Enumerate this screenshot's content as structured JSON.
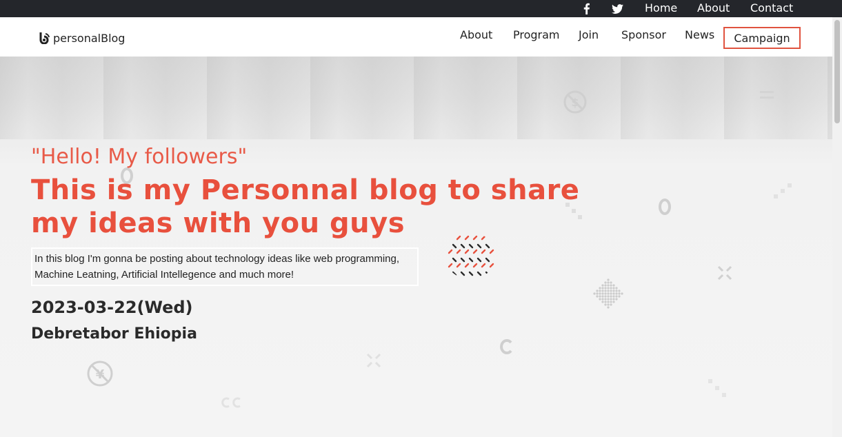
{
  "topbar": {
    "social_icons": [
      "facebook-icon",
      "twitter-icon"
    ],
    "links": [
      "Home",
      "About",
      "Contact"
    ]
  },
  "navbar": {
    "logo_text": "personalBlog",
    "items": [
      "About",
      "Program",
      "Join",
      "Sponsor",
      "News"
    ],
    "campaign_label": "Campaign"
  },
  "hero": {
    "greeting": "\"Hello! My followers\"",
    "headline_line1": "This is my Personnal blog to share",
    "headline_line2": "my ideas with you guys",
    "description_line1": "In this blog I'm gonna be posting about technology ideas like web programming,",
    "description_line2": "Machine Leatning, Artificial Intellegence and much more!",
    "date": "2023-03-22(Wed)",
    "location": "Debretabor Ehiopia"
  },
  "colors": {
    "accent": "#e8503d",
    "topbar_bg": "#24262b",
    "campaign_border": "#e0523e"
  }
}
